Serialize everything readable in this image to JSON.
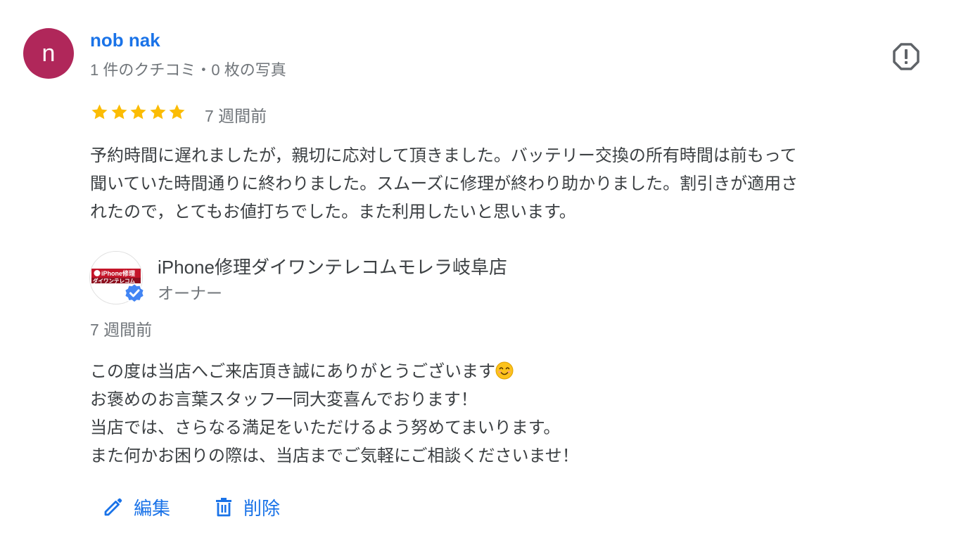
{
  "reviewer": {
    "initial": "n",
    "name": "nob nak",
    "meta": "1 件のクチコミ・0 枚の写真",
    "avatar_color": "#b0275a"
  },
  "review": {
    "rating": 5,
    "max_rating": 5,
    "time": "7 週間前",
    "lines": [
      "予約時間に遅れましたが，親切に応対して頂きました。バッテリー交換の所有時間は前もって",
      "聞いていた時間通りに終わりました。スムーズに修理が終わり助かりました。割引きが適用さ",
      "れたので，とてもお値打ちでした。また利用したいと思います。"
    ]
  },
  "owner": {
    "name": "iPhone修理ダイワンテレコムモレラ岐阜店",
    "role": "オーナー",
    "logo_text_top": "iPhone修理",
    "logo_text_bottom": "ダイワンテレコム",
    "reply_time": "7 週間前",
    "reply_lines": [
      "この度は当店へご来店頂き誠にありがとうございます",
      "お褒めのお言葉スタッフ一同大変喜んでおります！",
      "当店では、さらなる満足をいただけるよう努めてまいります。",
      "また何かお困りの際は、当店までご気軽にご相談くださいませ！"
    ]
  },
  "actions": {
    "edit_label": "編集",
    "delete_label": "削除"
  },
  "colors": {
    "accent": "#1a73e8",
    "star": "#fbbc04",
    "muted_text": "#70757a"
  },
  "icons": [
    "flag-icon",
    "star-icon",
    "verified-badge-icon",
    "smiley-emoji",
    "pencil-icon",
    "trash-icon"
  ]
}
